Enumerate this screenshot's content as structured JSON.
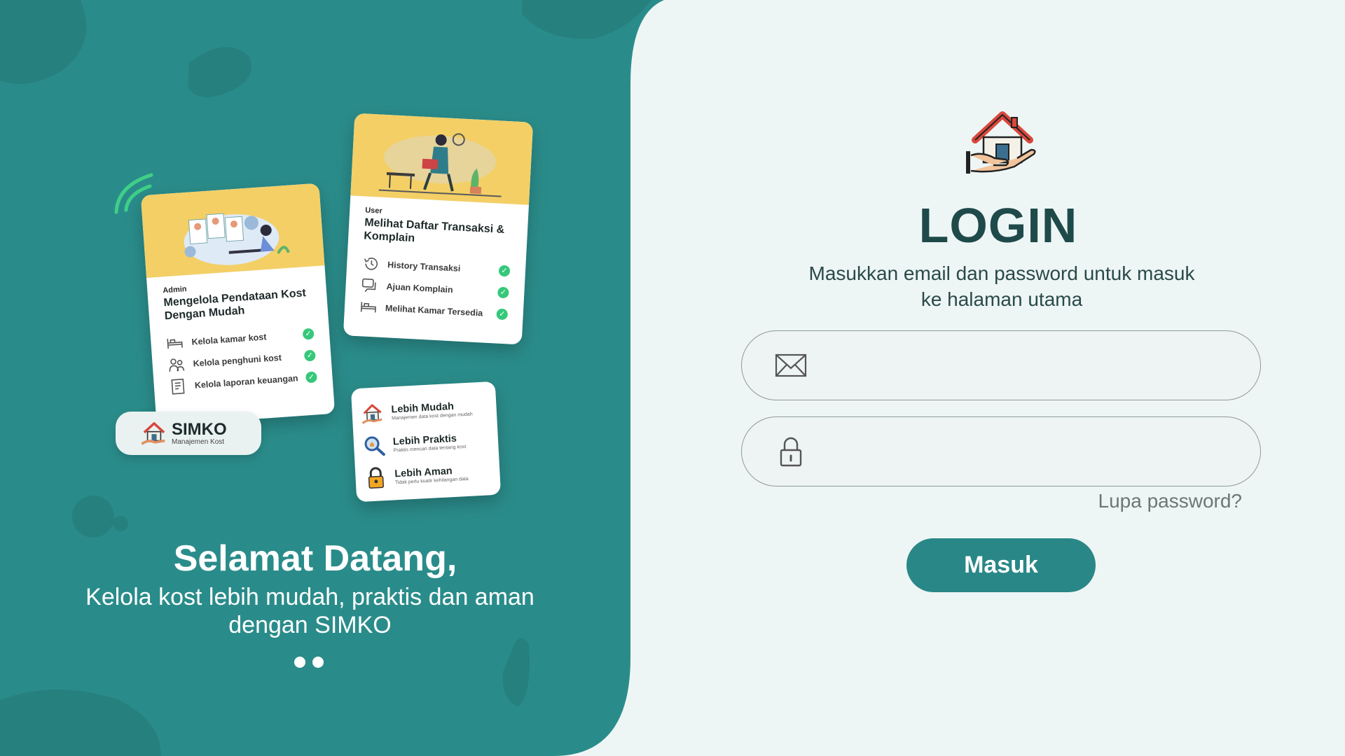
{
  "colors": {
    "primary": "#2a8c8a",
    "accent_yellow": "#f3cf66",
    "check_green": "#35c87a",
    "right_bg": "#eef6f5"
  },
  "illustration": {
    "admin_card": {
      "role": "Admin",
      "title": "Mengelola Pendataan Kost Dengan Mudah",
      "items": [
        {
          "label": "Kelola kamar kost",
          "icon": "bed-icon"
        },
        {
          "label": "Kelola penghuni kost",
          "icon": "people-icon"
        },
        {
          "label": "Kelola laporan keuangan",
          "icon": "report-icon"
        }
      ]
    },
    "user_card": {
      "role": "User",
      "title": "Melihat Daftar Transaksi & Komplain",
      "items": [
        {
          "label": "History Transaksi",
          "icon": "history-icon"
        },
        {
          "label": "Ajuan Komplain",
          "icon": "chat-icon"
        },
        {
          "label": "Melihat Kamar Tersedia",
          "icon": "bed-icon"
        }
      ]
    },
    "benefits": [
      {
        "title": "Lebih Mudah",
        "subtitle": "Manajemen data kost dengan mudah",
        "icon": "house-hand-icon"
      },
      {
        "title": "Lebih Praktis",
        "subtitle": "Praktis mencari data tentang kost",
        "icon": "magnifier-icon"
      },
      {
        "title": "Lebih Aman",
        "subtitle": "Tidak perlu kuatir kehilangan data",
        "icon": "padlock-icon"
      }
    ],
    "brand": {
      "name": "SIMKO",
      "tagline": "Manajemen Kost"
    }
  },
  "welcome": {
    "title": "Selamat Datang,",
    "subtitle": "Kelola kost lebih mudah, praktis dan aman dengan SIMKO",
    "slide_count": 2
  },
  "login": {
    "title": "LOGIN",
    "subtitle": "Masukkan email dan password untuk masuk ke halaman utama",
    "email": {
      "value": "",
      "placeholder": ""
    },
    "password": {
      "value": "",
      "placeholder": ""
    },
    "forgot_label": "Lupa password?",
    "submit_label": "Masuk"
  }
}
